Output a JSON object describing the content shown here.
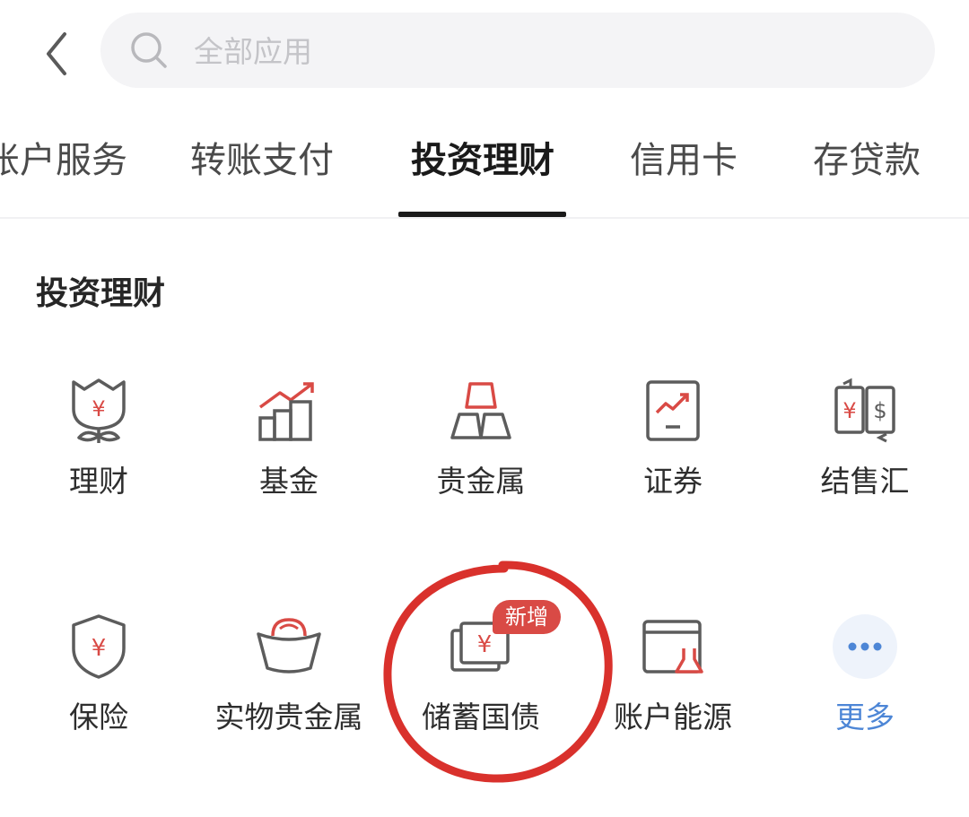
{
  "search": {
    "placeholder": "全部应用"
  },
  "tabs": [
    {
      "label": "账户服务"
    },
    {
      "label": "转账支付"
    },
    {
      "label": "投资理财",
      "active": true
    },
    {
      "label": "信用卡"
    },
    {
      "label": "存贷款"
    }
  ],
  "section": {
    "title": "投资理财",
    "items": [
      {
        "label": "理财",
        "icon": "wealth-flower-icon"
      },
      {
        "label": "基金",
        "icon": "fund-chart-icon"
      },
      {
        "label": "贵金属",
        "icon": "gold-bars-icon"
      },
      {
        "label": "证券",
        "icon": "securities-icon"
      },
      {
        "label": "结售汇",
        "icon": "currency-exchange-icon"
      },
      {
        "label": "保险",
        "icon": "insurance-shield-icon"
      },
      {
        "label": "实物贵金属",
        "icon": "gold-ingot-icon"
      },
      {
        "label": "储蓄国债",
        "icon": "savings-bond-icon",
        "badge": "新增"
      },
      {
        "label": "账户能源",
        "icon": "account-energy-icon"
      },
      {
        "label": "更多",
        "icon": "more-icon"
      }
    ]
  },
  "colors": {
    "accent_red": "#d94a45",
    "icon_gray": "#5c5c5c",
    "more_blue": "#4d86d6",
    "active_tab": "#1a1a1a"
  }
}
